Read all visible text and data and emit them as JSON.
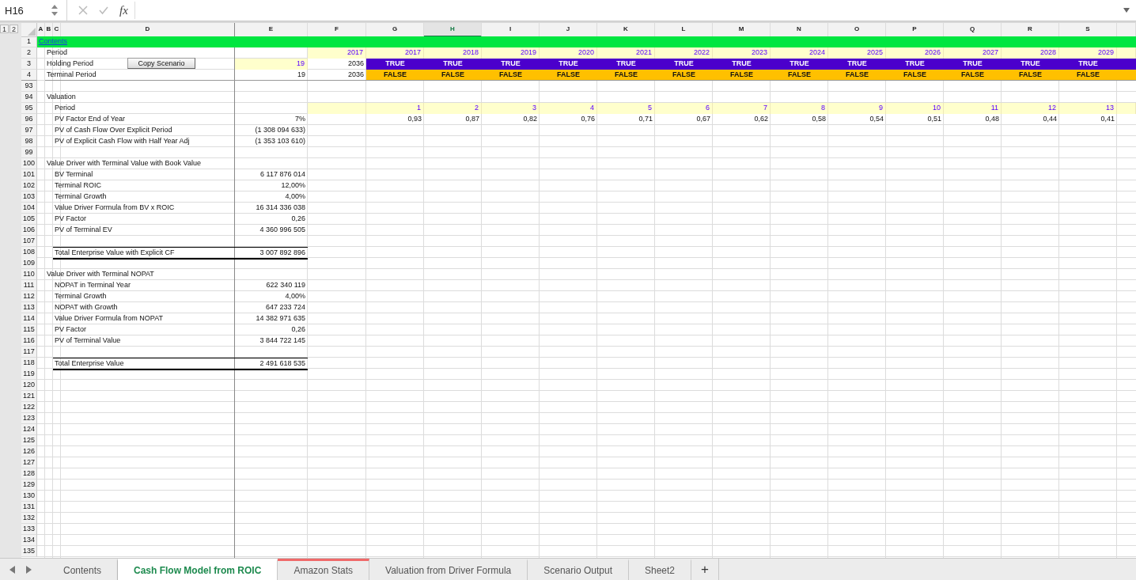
{
  "formula_bar": {
    "name_box": "H16",
    "function_label": "fx"
  },
  "outline_levels": [
    "1",
    "2"
  ],
  "columns": [
    {
      "letter": "A",
      "selected": false
    },
    {
      "letter": "B",
      "selected": false
    },
    {
      "letter": "C",
      "selected": false
    },
    {
      "letter": "D",
      "selected": false
    },
    {
      "letter": "E",
      "selected": false
    },
    {
      "letter": "F",
      "selected": false
    },
    {
      "letter": "G",
      "selected": false
    },
    {
      "letter": "H",
      "selected": true
    },
    {
      "letter": "I",
      "selected": false
    },
    {
      "letter": "J",
      "selected": false
    },
    {
      "letter": "K",
      "selected": false
    },
    {
      "letter": "L",
      "selected": false
    },
    {
      "letter": "M",
      "selected": false
    },
    {
      "letter": "N",
      "selected": false
    },
    {
      "letter": "O",
      "selected": false
    },
    {
      "letter": "P",
      "selected": false
    },
    {
      "letter": "Q",
      "selected": false
    },
    {
      "letter": "R",
      "selected": false
    },
    {
      "letter": "S",
      "selected": false
    }
  ],
  "rows": [
    {
      "number": "1",
      "kind": "title",
      "label": "Contents"
    },
    {
      "number": "2",
      "kind": "section",
      "label": "Period",
      "cells": [
        null,
        {
          "kind": "input",
          "value": "2017"
        },
        {
          "kind": "input",
          "value": "2017"
        },
        {
          "kind": "input",
          "value": "2018"
        },
        {
          "kind": "input",
          "value": "2019"
        },
        {
          "kind": "input",
          "value": "2020"
        },
        {
          "kind": "input",
          "value": "2021"
        },
        {
          "kind": "input",
          "value": "2022"
        },
        {
          "kind": "input",
          "value": "2023"
        },
        {
          "kind": "input",
          "value": "2024"
        },
        {
          "kind": "input",
          "value": "2025"
        },
        {
          "kind": "input",
          "value": "2026"
        },
        {
          "kind": "input",
          "value": "2027"
        },
        {
          "kind": "input",
          "value": "2028"
        },
        {
          "kind": "input",
          "value": "2029"
        },
        {
          "kind": "input"
        }
      ]
    },
    {
      "number": "3",
      "kind": "section",
      "label": "Holding Period",
      "button": "Copy Scenario",
      "cells": [
        {
          "kind": "input",
          "value": "19"
        },
        {
          "kind": "plain",
          "value": "2036"
        },
        {
          "kind": "flag-true",
          "value": "TRUE"
        },
        {
          "kind": "flag-true",
          "value": "TRUE"
        },
        {
          "kind": "flag-true",
          "value": "TRUE"
        },
        {
          "kind": "flag-true",
          "value": "TRUE"
        },
        {
          "kind": "flag-true",
          "value": "TRUE"
        },
        {
          "kind": "flag-true",
          "value": "TRUE"
        },
        {
          "kind": "flag-true",
          "value": "TRUE"
        },
        {
          "kind": "flag-true",
          "value": "TRUE"
        },
        {
          "kind": "flag-true",
          "value": "TRUE"
        },
        {
          "kind": "flag-true",
          "value": "TRUE"
        },
        {
          "kind": "flag-true",
          "value": "TRUE"
        },
        {
          "kind": "flag-true",
          "value": "TRUE"
        },
        {
          "kind": "flag-true",
          "value": "TRUE"
        },
        {
          "kind": "flag-true"
        }
      ]
    },
    {
      "number": "4",
      "kind": "section",
      "label": "Terminal Period",
      "cells": [
        {
          "kind": "plain",
          "value": "19"
        },
        {
          "kind": "plain",
          "value": "2036"
        },
        {
          "kind": "flag-false",
          "value": "FALSE"
        },
        {
          "kind": "flag-false",
          "value": "FALSE"
        },
        {
          "kind": "flag-false",
          "value": "FALSE"
        },
        {
          "kind": "flag-false",
          "value": "FALSE"
        },
        {
          "kind": "flag-false",
          "value": "FALSE"
        },
        {
          "kind": "flag-false",
          "value": "FALSE"
        },
        {
          "kind": "flag-false",
          "value": "FALSE"
        },
        {
          "kind": "flag-false",
          "value": "FALSE"
        },
        {
          "kind": "flag-false",
          "value": "FALSE"
        },
        {
          "kind": "flag-false",
          "value": "FALSE"
        },
        {
          "kind": "flag-false",
          "value": "FALSE"
        },
        {
          "kind": "flag-false",
          "value": "FALSE"
        },
        {
          "kind": "flag-false",
          "value": "FALSE"
        },
        {
          "kind": "flag-false"
        }
      ]
    },
    {
      "number": "93",
      "kind": "blank"
    },
    {
      "number": "94",
      "kind": "section",
      "label": "Valuation"
    },
    {
      "number": "95",
      "kind": "item",
      "label": "Period",
      "cells": [
        null,
        {
          "kind": "input"
        },
        {
          "kind": "input",
          "value": "1"
        },
        {
          "kind": "input",
          "value": "2"
        },
        {
          "kind": "input",
          "value": "3"
        },
        {
          "kind": "input",
          "value": "4"
        },
        {
          "kind": "input",
          "value": "5"
        },
        {
          "kind": "input",
          "value": "6"
        },
        {
          "kind": "input",
          "value": "7"
        },
        {
          "kind": "input",
          "value": "8"
        },
        {
          "kind": "input",
          "value": "9"
        },
        {
          "kind": "input",
          "value": "10"
        },
        {
          "kind": "input",
          "value": "11"
        },
        {
          "kind": "input",
          "value": "12"
        },
        {
          "kind": "input",
          "value": "13"
        },
        {
          "kind": "input"
        }
      ]
    },
    {
      "number": "96",
      "kind": "item",
      "label": "PV Factor End of Year",
      "cells": [
        {
          "kind": "plain",
          "value": "7%"
        },
        null,
        {
          "kind": "plain",
          "value": "0,93"
        },
        {
          "kind": "plain",
          "value": "0,87"
        },
        {
          "kind": "plain",
          "value": "0,82"
        },
        {
          "kind": "plain",
          "value": "0,76"
        },
        {
          "kind": "plain",
          "value": "0,71"
        },
        {
          "kind": "plain",
          "value": "0,67"
        },
        {
          "kind": "plain",
          "value": "0,62"
        },
        {
          "kind": "plain",
          "value": "0,58"
        },
        {
          "kind": "plain",
          "value": "0,54"
        },
        {
          "kind": "plain",
          "value": "0,51"
        },
        {
          "kind": "plain",
          "value": "0,48"
        },
        {
          "kind": "plain",
          "value": "0,44"
        },
        {
          "kind": "plain",
          "value": "0,41"
        }
      ]
    },
    {
      "number": "97",
      "kind": "item",
      "label": "PV of Cash Flow Over Explicit Period",
      "cells": [
        {
          "kind": "plain",
          "value": "(1 308 094 633)"
        }
      ]
    },
    {
      "number": "98",
      "kind": "item",
      "label": "PV of Explicit Cash Flow with Half Year Adj",
      "cells": [
        {
          "kind": "plain",
          "value": "(1 353 103 610)"
        }
      ]
    },
    {
      "number": "99",
      "kind": "blank"
    },
    {
      "number": "100",
      "kind": "section",
      "label": "Value Driver with Terminal Value with Book Value"
    },
    {
      "number": "101",
      "kind": "item",
      "label": "BV Terminal",
      "cells": [
        {
          "kind": "plain",
          "value": "6 117 876 014"
        }
      ]
    },
    {
      "number": "102",
      "kind": "item",
      "label": "Terminal ROIC",
      "cells": [
        {
          "kind": "plain",
          "value": "12,00%"
        }
      ]
    },
    {
      "number": "103",
      "kind": "item",
      "label": "Terminal Growth",
      "cells": [
        {
          "kind": "plain",
          "value": "4,00%"
        }
      ]
    },
    {
      "number": "104",
      "kind": "item",
      "label": "Value Driver Formula from BV x ROIC",
      "cells": [
        {
          "kind": "plain",
          "value": "16 314 336 038"
        }
      ]
    },
    {
      "number": "105",
      "kind": "item",
      "label": "PV Factor",
      "cells": [
        {
          "kind": "plain",
          "value": "0,26"
        }
      ]
    },
    {
      "number": "106",
      "kind": "item",
      "label": "PV of Terminal EV",
      "cells": [
        {
          "kind": "plain",
          "value": "4 360 996 505"
        }
      ]
    },
    {
      "number": "107",
      "kind": "blank"
    },
    {
      "number": "108",
      "kind": "total",
      "label": "Total Enterprise Value with Explicit CF",
      "cells": [
        {
          "kind": "plain",
          "value": "3 007 892 896"
        }
      ]
    },
    {
      "number": "109",
      "kind": "blank"
    },
    {
      "number": "110",
      "kind": "section",
      "label": "Value Driver with Terminal NOPAT"
    },
    {
      "number": "111",
      "kind": "item",
      "label": "NOPAT in Terminal Year",
      "cells": [
        {
          "kind": "plain",
          "value": "622 340 119"
        }
      ]
    },
    {
      "number": "112",
      "kind": "item",
      "label": "Terminal Growth",
      "cells": [
        {
          "kind": "plain",
          "value": "4,00%"
        }
      ]
    },
    {
      "number": "113",
      "kind": "item",
      "label": "NOPAT with Growth",
      "cells": [
        {
          "kind": "plain",
          "value": "647 233 724"
        }
      ]
    },
    {
      "number": "114",
      "kind": "item",
      "label": "Value Driver Formula from NOPAT",
      "cells": [
        {
          "kind": "plain",
          "value": "14 382 971 635"
        }
      ]
    },
    {
      "number": "115",
      "kind": "item",
      "label": "PV Factor",
      "cells": [
        {
          "kind": "plain",
          "value": "0,26"
        }
      ]
    },
    {
      "number": "116",
      "kind": "item",
      "label": "PV of Terminal Value",
      "cells": [
        {
          "kind": "plain",
          "value": "3 844 722 145"
        }
      ]
    },
    {
      "number": "117",
      "kind": "blank"
    },
    {
      "number": "118",
      "kind": "total",
      "label": "Total Enterprise Value",
      "cells": [
        {
          "kind": "plain",
          "value": "2 491 618 535"
        }
      ]
    },
    {
      "number": "119",
      "kind": "blank"
    },
    {
      "number": "120",
      "kind": "blank"
    },
    {
      "number": "121",
      "kind": "blank"
    },
    {
      "number": "122",
      "kind": "blank"
    },
    {
      "number": "123",
      "kind": "blank"
    },
    {
      "number": "124",
      "kind": "blank"
    },
    {
      "number": "125",
      "kind": "blank"
    },
    {
      "number": "126",
      "kind": "blank"
    },
    {
      "number": "127",
      "kind": "blank"
    },
    {
      "number": "128",
      "kind": "blank"
    },
    {
      "number": "129",
      "kind": "blank"
    },
    {
      "number": "130",
      "kind": "blank"
    },
    {
      "number": "131",
      "kind": "blank"
    },
    {
      "number": "132",
      "kind": "blank"
    },
    {
      "number": "133",
      "kind": "blank"
    },
    {
      "number": "134",
      "kind": "blank"
    },
    {
      "number": "135",
      "kind": "blank"
    }
  ],
  "sheet_tabs": [
    {
      "label": "Contents",
      "selected": false
    },
    {
      "label": "Cash Flow Model from ROIC",
      "selected": true
    },
    {
      "label": "Amazon Stats",
      "selected": false,
      "color": "#f06a6a"
    },
    {
      "label": "Valuation from Driver Formula",
      "selected": false
    },
    {
      "label": "Scenario Output",
      "selected": false
    },
    {
      "label": "Sheet2",
      "selected": false
    }
  ],
  "add_sheet_button": "+"
}
